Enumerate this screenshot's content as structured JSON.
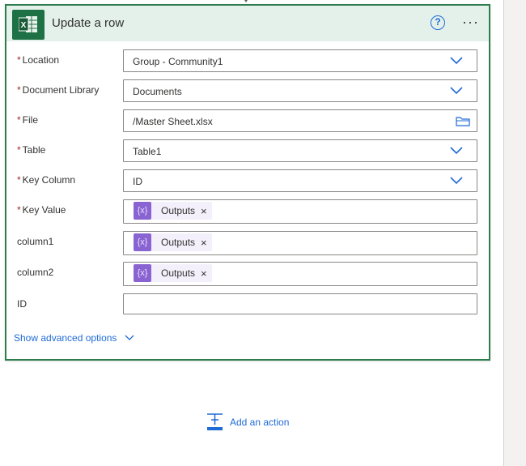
{
  "card": {
    "title": "Update a row",
    "help_icon": "?",
    "more_icon": "···",
    "app_icon": "excel-icon",
    "accent_color": "#2f7d4f"
  },
  "fields": {
    "location": {
      "label": "Location",
      "required": true,
      "value": "Group - Community1",
      "type": "dropdown"
    },
    "document_library": {
      "label": "Document Library",
      "required": true,
      "value": "Documents",
      "type": "dropdown"
    },
    "file": {
      "label": "File",
      "required": true,
      "value": "/Master Sheet.xlsx",
      "type": "file-picker"
    },
    "table": {
      "label": "Table",
      "required": true,
      "value": "Table1",
      "type": "dropdown"
    },
    "key_column": {
      "label": "Key Column",
      "required": true,
      "value": "ID",
      "type": "dropdown"
    },
    "key_value": {
      "label": "Key Value",
      "required": true,
      "token": "Outputs",
      "type": "token"
    },
    "column1": {
      "label": "column1",
      "required": false,
      "token": "Outputs",
      "type": "token"
    },
    "column2": {
      "label": "column2",
      "required": false,
      "token": "Outputs",
      "type": "token"
    },
    "id": {
      "label": "ID",
      "required": false,
      "value": "",
      "type": "text"
    }
  },
  "required_marker": "*",
  "token_close": "×",
  "token_icon": "{x}",
  "advanced_options": "Show advanced options",
  "add_action": "Add an action"
}
